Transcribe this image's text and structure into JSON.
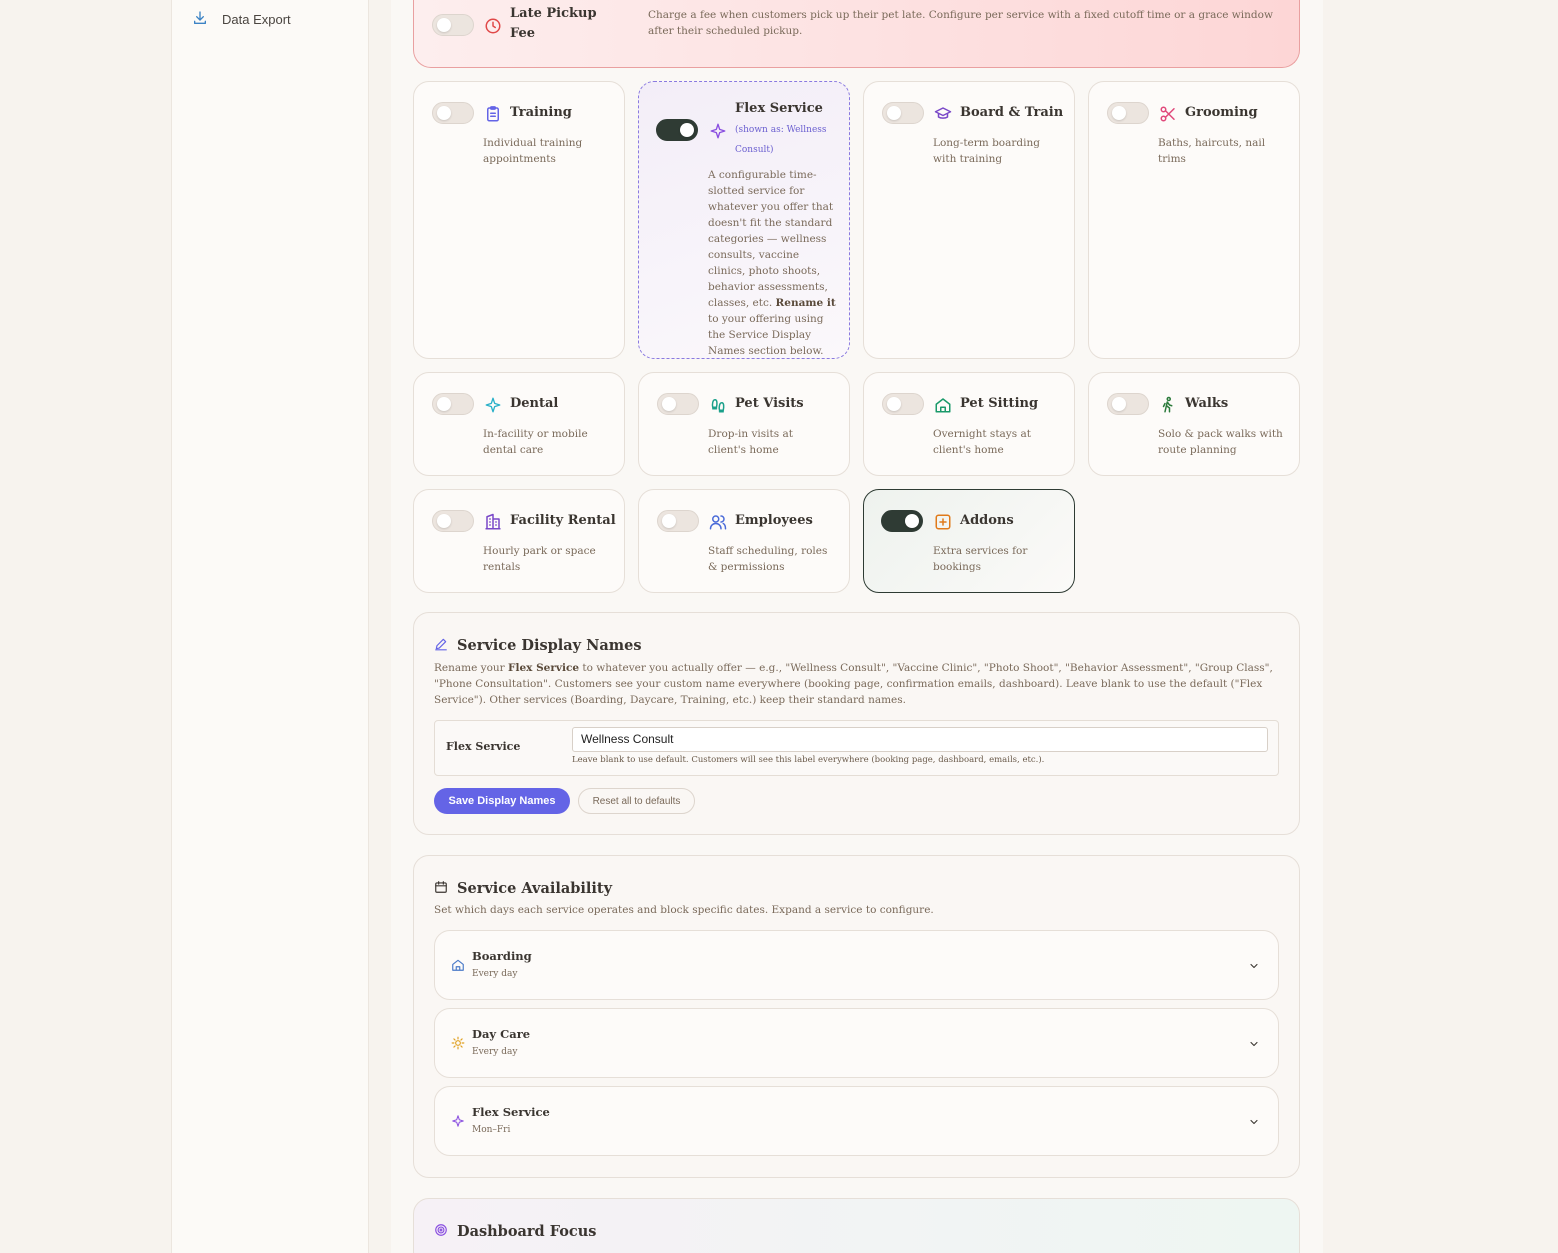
{
  "sidebar": {
    "items": [
      {
        "label": "Data Export",
        "icon": "download-icon"
      }
    ]
  },
  "late_pickup": {
    "title": "Late Pickup Fee",
    "description": "Charge a fee when customers pick up their pet late. Configure per service with a fixed cutoff time or a grace window after their scheduled pickup.",
    "enabled": false
  },
  "services": [
    {
      "key": "training",
      "title": "Training",
      "description": "Individual training appointments",
      "icon": "clipboard-icon",
      "icon_color": "#6464e6",
      "enabled": false
    },
    {
      "key": "flex",
      "title": "Flex Service",
      "shown_as": "(shown as: Wellness Consult)",
      "description_before": "A configurable time-slotted service for whatever you offer that doesn't fit the standard categories — wellness consults, vaccine clinics, photo shoots, behavior assessments, classes, etc. ",
      "description_bold": "Rename it",
      "description_after": " to your offering using the Service Display Names section below.",
      "icon": "sparkle-icon",
      "icon_color": "#8a4fe0",
      "enabled": true
    },
    {
      "key": "board_train",
      "title": "Board & Train",
      "description": "Long-term boarding with training",
      "icon": "graduation-cap-icon",
      "icon_color": "#7a48c8",
      "enabled": false
    },
    {
      "key": "grooming",
      "title": "Grooming",
      "description": "Baths, haircuts, nail trims",
      "icon": "scissors-icon",
      "icon_color": "#e0487a",
      "enabled": false
    },
    {
      "key": "dental",
      "title": "Dental",
      "description": "In-facility or mobile dental care",
      "icon": "sparkle-icon",
      "icon_color": "#2ab0c8",
      "enabled": false
    },
    {
      "key": "pet_visits",
      "title": "Pet Visits",
      "description": "Drop-in visits at client's home",
      "icon": "footprints-icon",
      "icon_color": "#1aa08a",
      "enabled": false
    },
    {
      "key": "pet_sitting",
      "title": "Pet Sitting",
      "description": "Overnight stays at client's home",
      "icon": "home-icon",
      "icon_color": "#1a9a6a",
      "enabled": false
    },
    {
      "key": "walks",
      "title": "Walks",
      "description": "Solo & pack walks with route planning",
      "icon": "walking-person-icon",
      "icon_color": "#2a7a3a",
      "enabled": false
    },
    {
      "key": "facility_rental",
      "title": "Facility Rental",
      "description": "Hourly park or space rentals",
      "icon": "building-icon",
      "icon_color": "#7a48c8",
      "enabled": false
    },
    {
      "key": "employees",
      "title": "Employees",
      "description": "Staff scheduling, roles & permissions",
      "icon": "users-icon",
      "icon_color": "#4a6ad8",
      "enabled": false
    },
    {
      "key": "addons",
      "title": "Addons",
      "description": "Extra services for bookings",
      "icon": "plus-square-icon",
      "icon_color": "#e07a1a",
      "enabled": true
    }
  ],
  "display_names": {
    "title": "Service Display Names",
    "intro_1": "Rename your ",
    "intro_bold": "Flex Service",
    "intro_2": " to whatever you actually offer — e.g., \"Wellness Consult\", \"Vaccine Clinic\", \"Photo Shoot\", \"Behavior Assessment\", \"Group Class\", \"Phone Consultation\". Customers see your custom name everywhere (booking page, confirmation emails, dashboard). Leave blank to use the default (\"Flex Service\"). Other services (Boarding, Daycare, Training, etc.) keep their standard names.",
    "field_label": "Flex Service",
    "field_value": "Wellness Consult",
    "field_hint": "Leave blank to use default. Customers will see this label everywhere (booking page, dashboard, emails, etc.).",
    "save_label": "Save Display Names",
    "reset_label": "Reset all to defaults",
    "accent_color": "#6464e6"
  },
  "availability": {
    "title": "Service Availability",
    "description": "Set which days each service operates and block specific dates. Expand a service to configure.",
    "rows": [
      {
        "name": "Boarding",
        "schedule": "Every day",
        "icon": "home-icon"
      },
      {
        "name": "Day Care",
        "schedule": "Every day",
        "icon": "sun-icon"
      },
      {
        "name": "Flex Service",
        "schedule": "Mon–Fri",
        "icon": "sparkle-icon"
      }
    ]
  },
  "dashboard_focus": {
    "title": "Dashboard Focus",
    "icon": "target-icon"
  }
}
